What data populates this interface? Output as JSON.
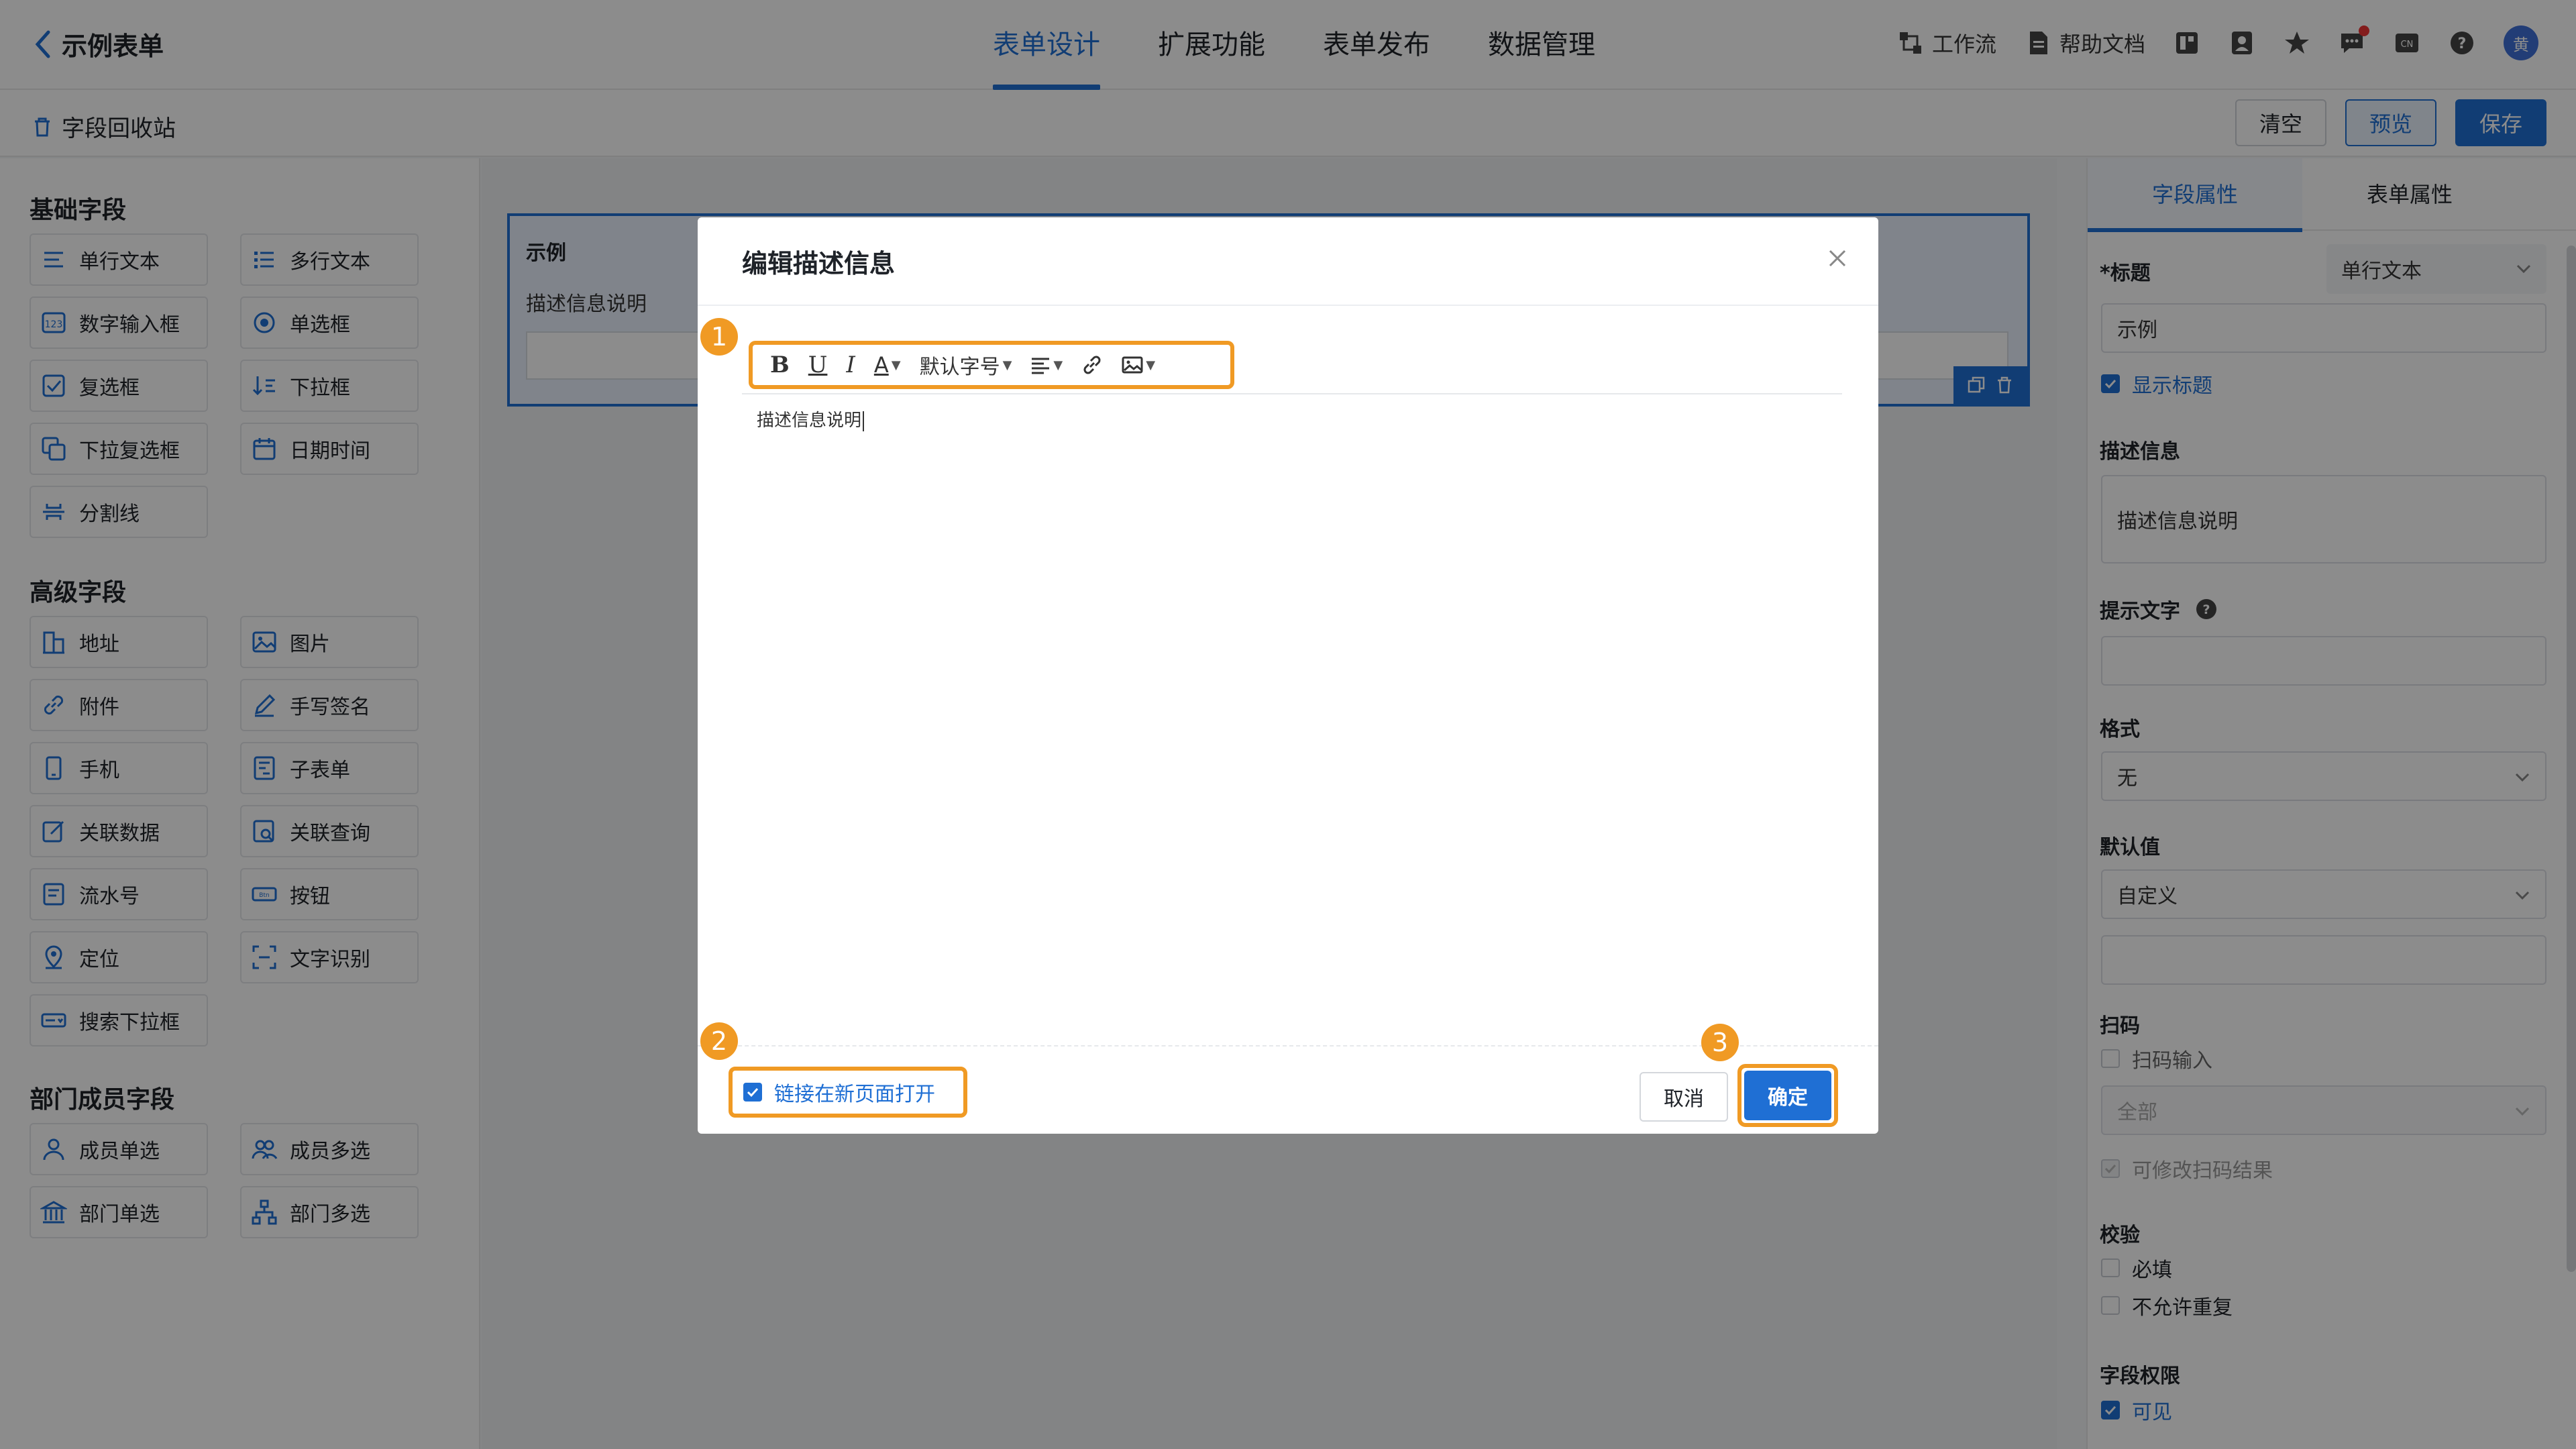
{
  "header": {
    "back_title": "示例表单",
    "tabs": [
      "表单设计",
      "扩展功能",
      "表单发布",
      "数据管理"
    ],
    "active_tab": 0,
    "workflow": "工作流",
    "help": "帮助文档",
    "avatar_text": "黄"
  },
  "toolbar": {
    "recycle": "字段回收站",
    "clear": "清空",
    "preview": "预览",
    "save": "保存"
  },
  "left_panel": {
    "basic_title": "基础字段",
    "basic": [
      "单行文本",
      "多行文本",
      "数字输入框",
      "单选框",
      "复选框",
      "下拉框",
      "下拉复选框",
      "日期时间",
      "分割线"
    ],
    "advanced_title": "高级字段",
    "advanced": [
      "地址",
      "图片",
      "附件",
      "手写签名",
      "手机",
      "子表单",
      "关联数据",
      "关联查询",
      "流水号",
      "按钮",
      "定位",
      "文字识别",
      "搜索下拉框"
    ],
    "member_title": "部门成员字段",
    "member": [
      "成员单选",
      "成员多选",
      "部门单选",
      "部门多选"
    ]
  },
  "canvas": {
    "field_title": "示例",
    "field_desc": "描述信息说明"
  },
  "right_panel": {
    "tabs": [
      "字段属性",
      "表单属性"
    ],
    "title_label": "*标题",
    "title_type": "单行文本",
    "title_value": "示例",
    "show_title": "显示标题",
    "desc_label": "描述信息",
    "desc_value": "描述信息说明",
    "hint_label": "提示文字",
    "format_label": "格式",
    "format_value": "无",
    "default_label": "默认值",
    "default_value": "自定义",
    "scan_label": "扫码",
    "scan_input": "扫码输入",
    "scan_scope": "全部",
    "scan_modify": "可修改扫码结果",
    "verify_label": "校验",
    "required": "必填",
    "no_repeat": "不允许重复",
    "perm_label": "字段权限",
    "visible": "可见"
  },
  "modal": {
    "title": "编辑描述信息",
    "font_size": "默认字号",
    "editor_text": "描述信息说明",
    "open_new_page": "链接在新页面打开",
    "cancel": "取消",
    "confirm": "确定",
    "badges": [
      "1",
      "2",
      "3"
    ]
  },
  "colors": {
    "accent": "#1f6fd4",
    "highlight": "#f09a24"
  }
}
